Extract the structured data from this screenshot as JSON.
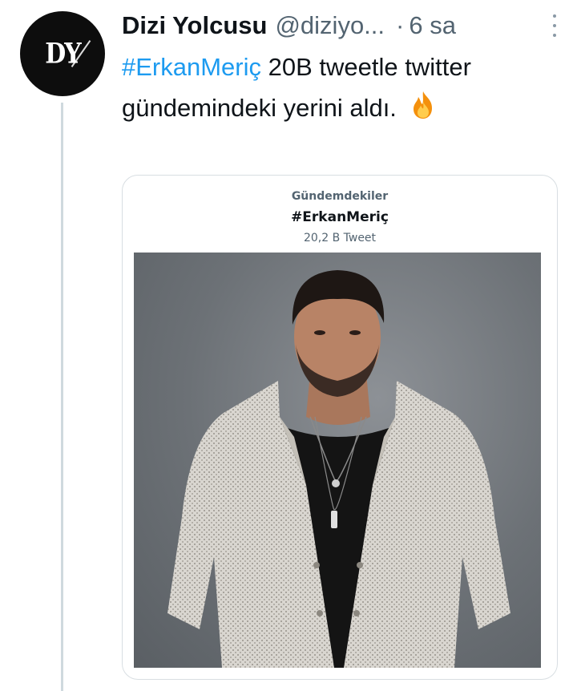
{
  "author": {
    "avatar_text": "DY",
    "name": "Dizi Yolcusu",
    "handle": "@diziyo...",
    "separator": "·",
    "time": "6 sa"
  },
  "tweet": {
    "hashtag": "#ErkanMeriç",
    "text": " 20B tweetle twitter gündemindeki yerini aldı. ",
    "emoji_icon": "fire-icon"
  },
  "media": {
    "category": "Gündemdekiler",
    "hashtag": "#ErkanMeriç",
    "count": "20,2 B Tweet",
    "photo_icon": "man-in-white-tweed-jacket-photo"
  },
  "colors": {
    "link": "#1d9bf0",
    "text": "#0f1419",
    "muted": "#536471",
    "thread_line": "#cfd9de"
  }
}
